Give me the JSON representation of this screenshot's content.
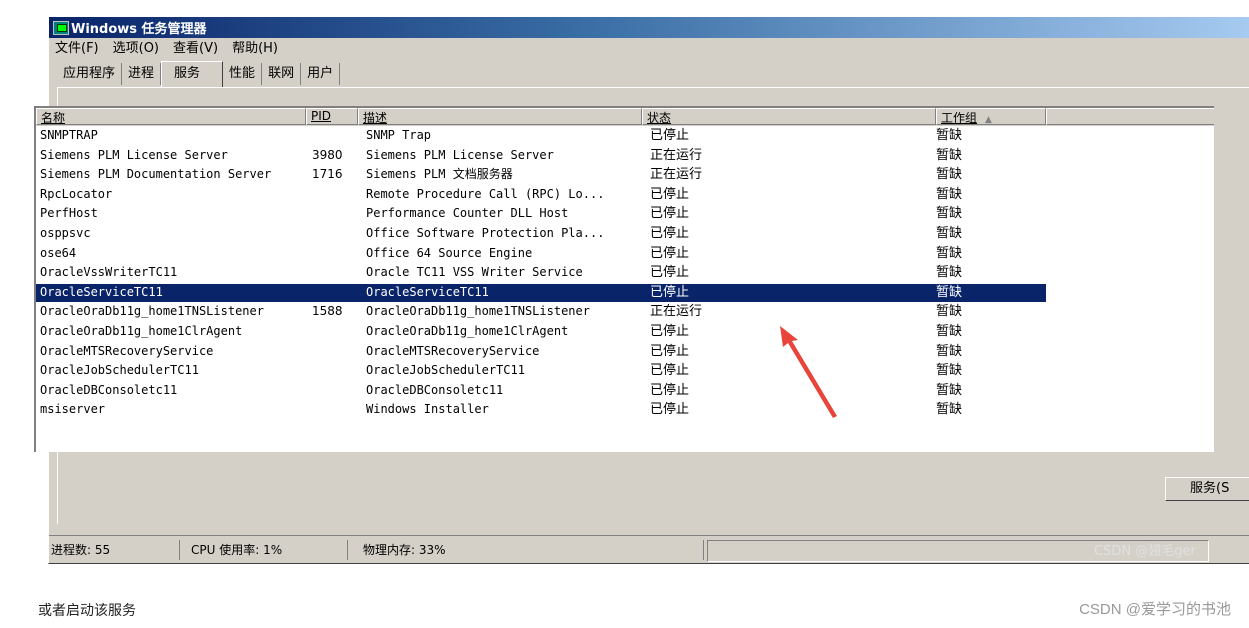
{
  "window": {
    "title": "Windows 任务管理器"
  },
  "menu": [
    "文件(F)",
    "选项(O)",
    "查看(V)",
    "帮助(H)"
  ],
  "tabs": [
    {
      "label": "应用程序",
      "active": false
    },
    {
      "label": "进程",
      "active": false
    },
    {
      "label": "服务",
      "active": true
    },
    {
      "label": "性能",
      "active": false
    },
    {
      "label": "联网",
      "active": false
    },
    {
      "label": "用户",
      "active": false
    }
  ],
  "table": {
    "columns": [
      "名称",
      "PID",
      "描述",
      "状态",
      "工作组"
    ],
    "sort_indicator": "▲",
    "rows": [
      {
        "name": "SNMPTRAP",
        "pid": "",
        "desc": "SNMP Trap",
        "status": "已停止",
        "group": "暂缺"
      },
      {
        "name": "Siemens PLM License Server",
        "pid": "3980",
        "desc": "Siemens PLM License Server",
        "status": "正在运行",
        "group": "暂缺"
      },
      {
        "name": "Siemens PLM Documentation Server",
        "pid": "1716",
        "desc": "Siemens PLM 文档服务器",
        "status": "正在运行",
        "group": "暂缺"
      },
      {
        "name": "RpcLocator",
        "pid": "",
        "desc": "Remote Procedure Call (RPC) Lo...",
        "status": "已停止",
        "group": "暂缺"
      },
      {
        "name": "PerfHost",
        "pid": "",
        "desc": "Performance Counter DLL Host",
        "status": "已停止",
        "group": "暂缺"
      },
      {
        "name": "osppsvc",
        "pid": "",
        "desc": "Office Software Protection Pla...",
        "status": "已停止",
        "group": "暂缺"
      },
      {
        "name": "ose64",
        "pid": "",
        "desc": "Office 64 Source Engine",
        "status": "已停止",
        "group": "暂缺"
      },
      {
        "name": "OracleVssWriterTC11",
        "pid": "",
        "desc": "Oracle TC11 VSS Writer Service",
        "status": "已停止",
        "group": "暂缺"
      },
      {
        "name": "OracleServiceTC11",
        "pid": "",
        "desc": "OracleServiceTC11",
        "status": "已停止",
        "group": "暂缺",
        "selected": true
      },
      {
        "name": "OracleOraDb11g_home1TNSListener",
        "pid": "1588",
        "desc": "OracleOraDb11g_home1TNSListener",
        "status": "正在运行",
        "group": "暂缺"
      },
      {
        "name": "OracleOraDb11g_home1ClrAgent",
        "pid": "",
        "desc": "OracleOraDb11g_home1ClrAgent",
        "status": "已停止",
        "group": "暂缺"
      },
      {
        "name": "OracleMTSRecoveryService",
        "pid": "",
        "desc": "OracleMTSRecoveryService",
        "status": "已停止",
        "group": "暂缺"
      },
      {
        "name": "OracleJobSchedulerTC11",
        "pid": "",
        "desc": "OracleJobSchedulerTC11",
        "status": "已停止",
        "group": "暂缺"
      },
      {
        "name": "OracleDBConsoletc11",
        "pid": "",
        "desc": "OracleDBConsoletc11",
        "status": "已停止",
        "group": "暂缺"
      },
      {
        "name": "msiserver",
        "pid": "",
        "desc": "Windows Installer",
        "status": "已停止",
        "group": "暂缺"
      }
    ]
  },
  "services_button": "服务(S",
  "statusbar": {
    "processes": "进程数: 55",
    "cpu": "CPU 使用率: 1%",
    "memory": "物理内存: 33%",
    "watermark": "CSDN @翅毛ger"
  },
  "page": {
    "caption": "或者启动该服务",
    "watermark": "CSDN @爱学习的书池"
  },
  "colors": {
    "selection": "#0a246a",
    "annotation_arrow": "#e8443a"
  }
}
